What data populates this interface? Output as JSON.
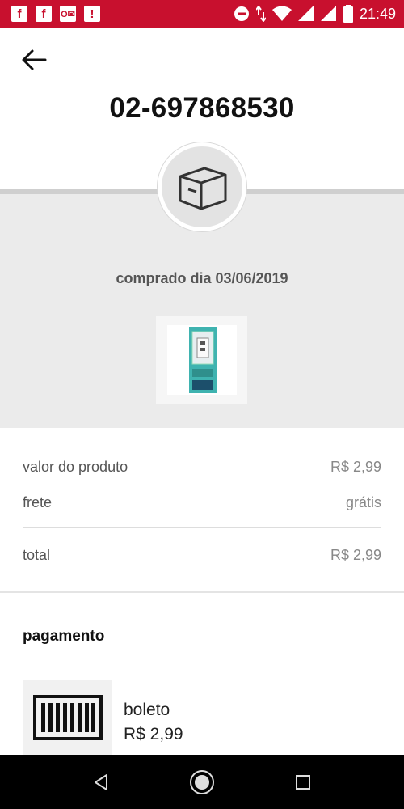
{
  "status_bar": {
    "time": "21:49",
    "background_color": "#c8102e",
    "left_icons": [
      "facebook-icon",
      "facebook-icon",
      "outlook-icon",
      "alert-app-icon"
    ],
    "right_icons": [
      "do-not-disturb-icon",
      "data-transfer-icon",
      "wifi-icon",
      "cell-signal-icon",
      "cell-signal-icon",
      "battery-icon"
    ]
  },
  "header": {
    "back_icon": "arrow-left-icon",
    "order_number": "02-697868530"
  },
  "order": {
    "box_icon": "package-box-icon",
    "purchase_date": "comprado dia 03/06/2019",
    "product_image": "usb-charger-product-image"
  },
  "pricing": {
    "product_label": "valor do produto",
    "product_value": "R$ 2,99",
    "shipping_label": "frete",
    "shipping_value": "grátis",
    "total_label": "total",
    "total_value": "R$ 2,99"
  },
  "payment": {
    "title": "pagamento",
    "method_icon": "barcode-icon",
    "method": "boleto",
    "amount": "R$ 2,99"
  },
  "nav_bar": {
    "back": "nav-back-icon",
    "home": "nav-home-icon",
    "recents": "nav-recents-icon"
  }
}
